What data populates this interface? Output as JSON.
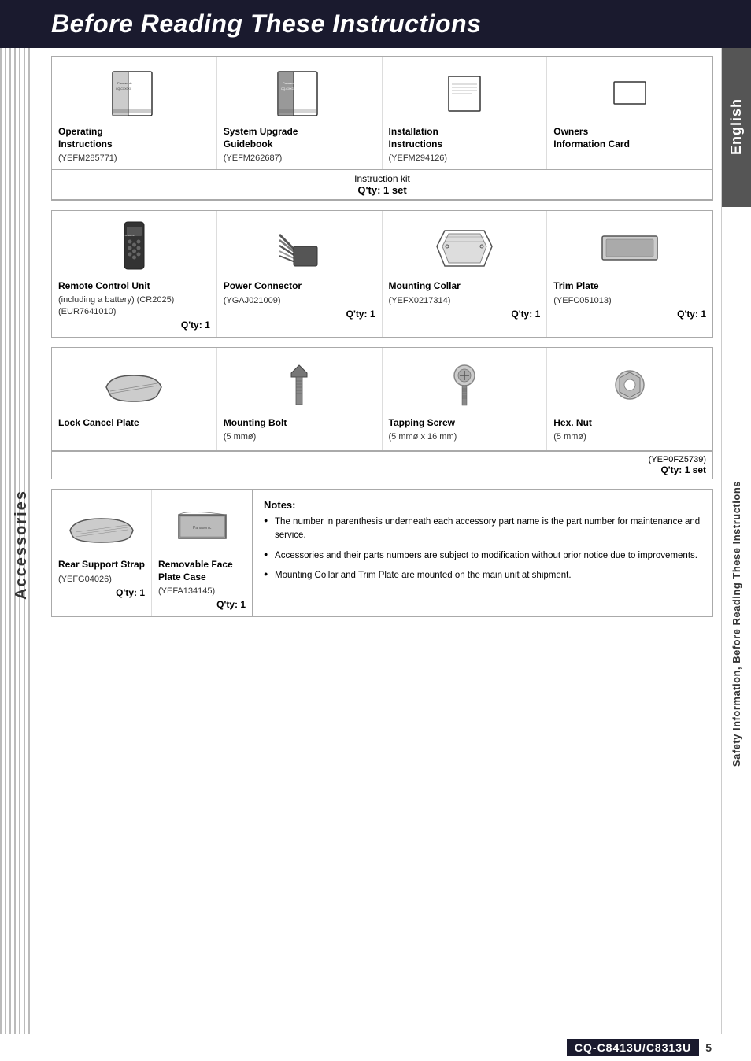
{
  "header": {
    "title": "Before Reading These Instructions"
  },
  "left_sidebar": {
    "label": "Accessories"
  },
  "right_sidebar": {
    "upper_label": "English",
    "lower_label": "Safety Information, Before Reading These Instructions"
  },
  "instruction_kit": {
    "label": "Instruction kit",
    "qty_label": "Q'ty: 1 set"
  },
  "accessories_row1": [
    {
      "name": "Operating Instructions",
      "part": "(YEFM285771)",
      "qty": ""
    },
    {
      "name": "System Upgrade Guidebook",
      "part": "(YEFM262687)",
      "qty": ""
    },
    {
      "name": "Installation Instructions",
      "part": "(YEFM294126)",
      "qty": ""
    },
    {
      "name": "Owners Information Card",
      "part": "",
      "qty": ""
    }
  ],
  "accessories_row2": [
    {
      "name": "Remote Control Unit",
      "sub": "(including a battery) (CR2025)",
      "part": "(EUR7641010)",
      "qty": "Q'ty: 1"
    },
    {
      "name": "Power Connector",
      "sub": "",
      "part": "(YGAJ021009)",
      "qty": "Q'ty: 1"
    },
    {
      "name": "Mounting Collar",
      "sub": "",
      "part": "(YEFX0217314)",
      "qty": "Q'ty: 1"
    },
    {
      "name": "Trim Plate",
      "sub": "",
      "part": "(YEFC051013)",
      "qty": "Q'ty: 1"
    }
  ],
  "accessories_row3": [
    {
      "name": "Lock Cancel Plate",
      "sub": "",
      "part": "",
      "qty": ""
    },
    {
      "name": "Mounting Bolt",
      "sub": "(5 mmø)",
      "part": "",
      "qty": ""
    },
    {
      "name": "Tapping Screw",
      "sub": "(5 mmø x 16 mm)",
      "part": "",
      "qty": ""
    },
    {
      "name": "Hex. Nut",
      "sub": "(5 mmø)",
      "part": "",
      "qty": ""
    }
  ],
  "hardware_footer": {
    "part": "(YEP0FZ5739)",
    "qty": "Q'ty: 1 set"
  },
  "accessories_bottom": [
    {
      "name": "Rear Support Strap",
      "part": "(YEFG04026)",
      "qty": "Q'ty: 1"
    },
    {
      "name": "Removable Face Plate Case",
      "part": "(YEFA134145)",
      "qty": "Q'ty: 1"
    }
  ],
  "notes": {
    "title": "Notes:",
    "items": [
      "The number in parenthesis underneath each accessory part name is the part number for maintenance and service.",
      "Accessories and their parts numbers are subject to modification without prior notice due to improvements.",
      "Mounting Collar and Trim Plate are mounted on the main unit at shipment."
    ]
  },
  "footer": {
    "model": "CQ-C8413U/C8313U",
    "page": "5"
  }
}
